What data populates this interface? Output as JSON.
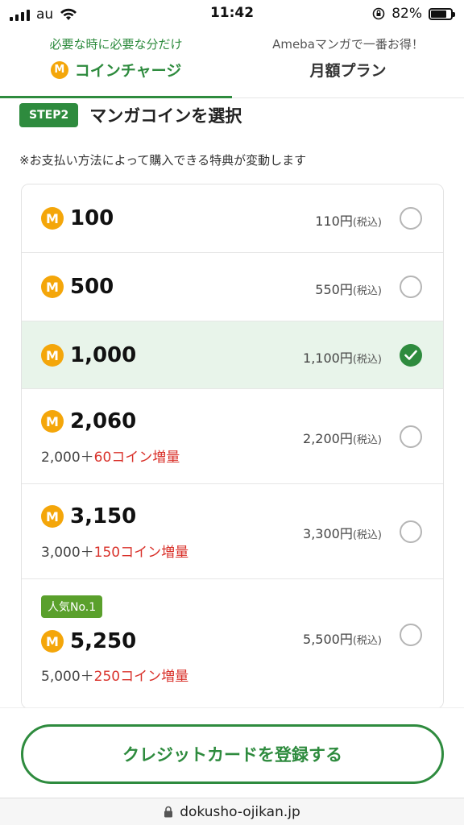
{
  "status_bar": {
    "carrier": "au",
    "time": "11:42",
    "battery": "82%",
    "battery_level": 0.82
  },
  "tabs": [
    {
      "subtitle": "必要な時に必要な分だけ",
      "label": "コインチャージ",
      "active": true
    },
    {
      "subtitle": "Amebaマンガで一番お得！",
      "label": "月額プラン",
      "active": false
    }
  ],
  "step": {
    "badge": "STEP2",
    "title": "マンガコインを選択"
  },
  "note": "※お支払い方法によって購入できる特典が変動します",
  "coin_icon_label": "M",
  "coin_options": [
    {
      "amount": "100",
      "price": "110円",
      "tax": "(税込)",
      "selected": false
    },
    {
      "amount": "500",
      "price": "550円",
      "tax": "(税込)",
      "selected": false
    },
    {
      "amount": "1,000",
      "price": "1,100円",
      "tax": "(税込)",
      "selected": true
    },
    {
      "amount": "2,060",
      "price": "2,200円",
      "tax": "(税込)",
      "selected": false,
      "bonus_base": "2,000＋",
      "bonus_extra": "60コイン増量"
    },
    {
      "amount": "3,150",
      "price": "3,300円",
      "tax": "(税込)",
      "selected": false,
      "bonus_base": "3,000＋",
      "bonus_extra": "150コイン増量"
    },
    {
      "amount": "5,250",
      "price": "5,500円",
      "tax": "(税込)",
      "selected": false,
      "bonus_base": "5,000＋",
      "bonus_extra": "250コイン増量",
      "badge": "人気No.1"
    }
  ],
  "register_button": "クレジットカードを登録する",
  "url": "dokusho-ojikan.jp",
  "colors": {
    "accent": "#2e8b3e",
    "coin": "#f4a60a",
    "bonus_red": "#d9322b",
    "selected_row": "#e8f4ea",
    "popular_badge": "#5aa02c"
  }
}
